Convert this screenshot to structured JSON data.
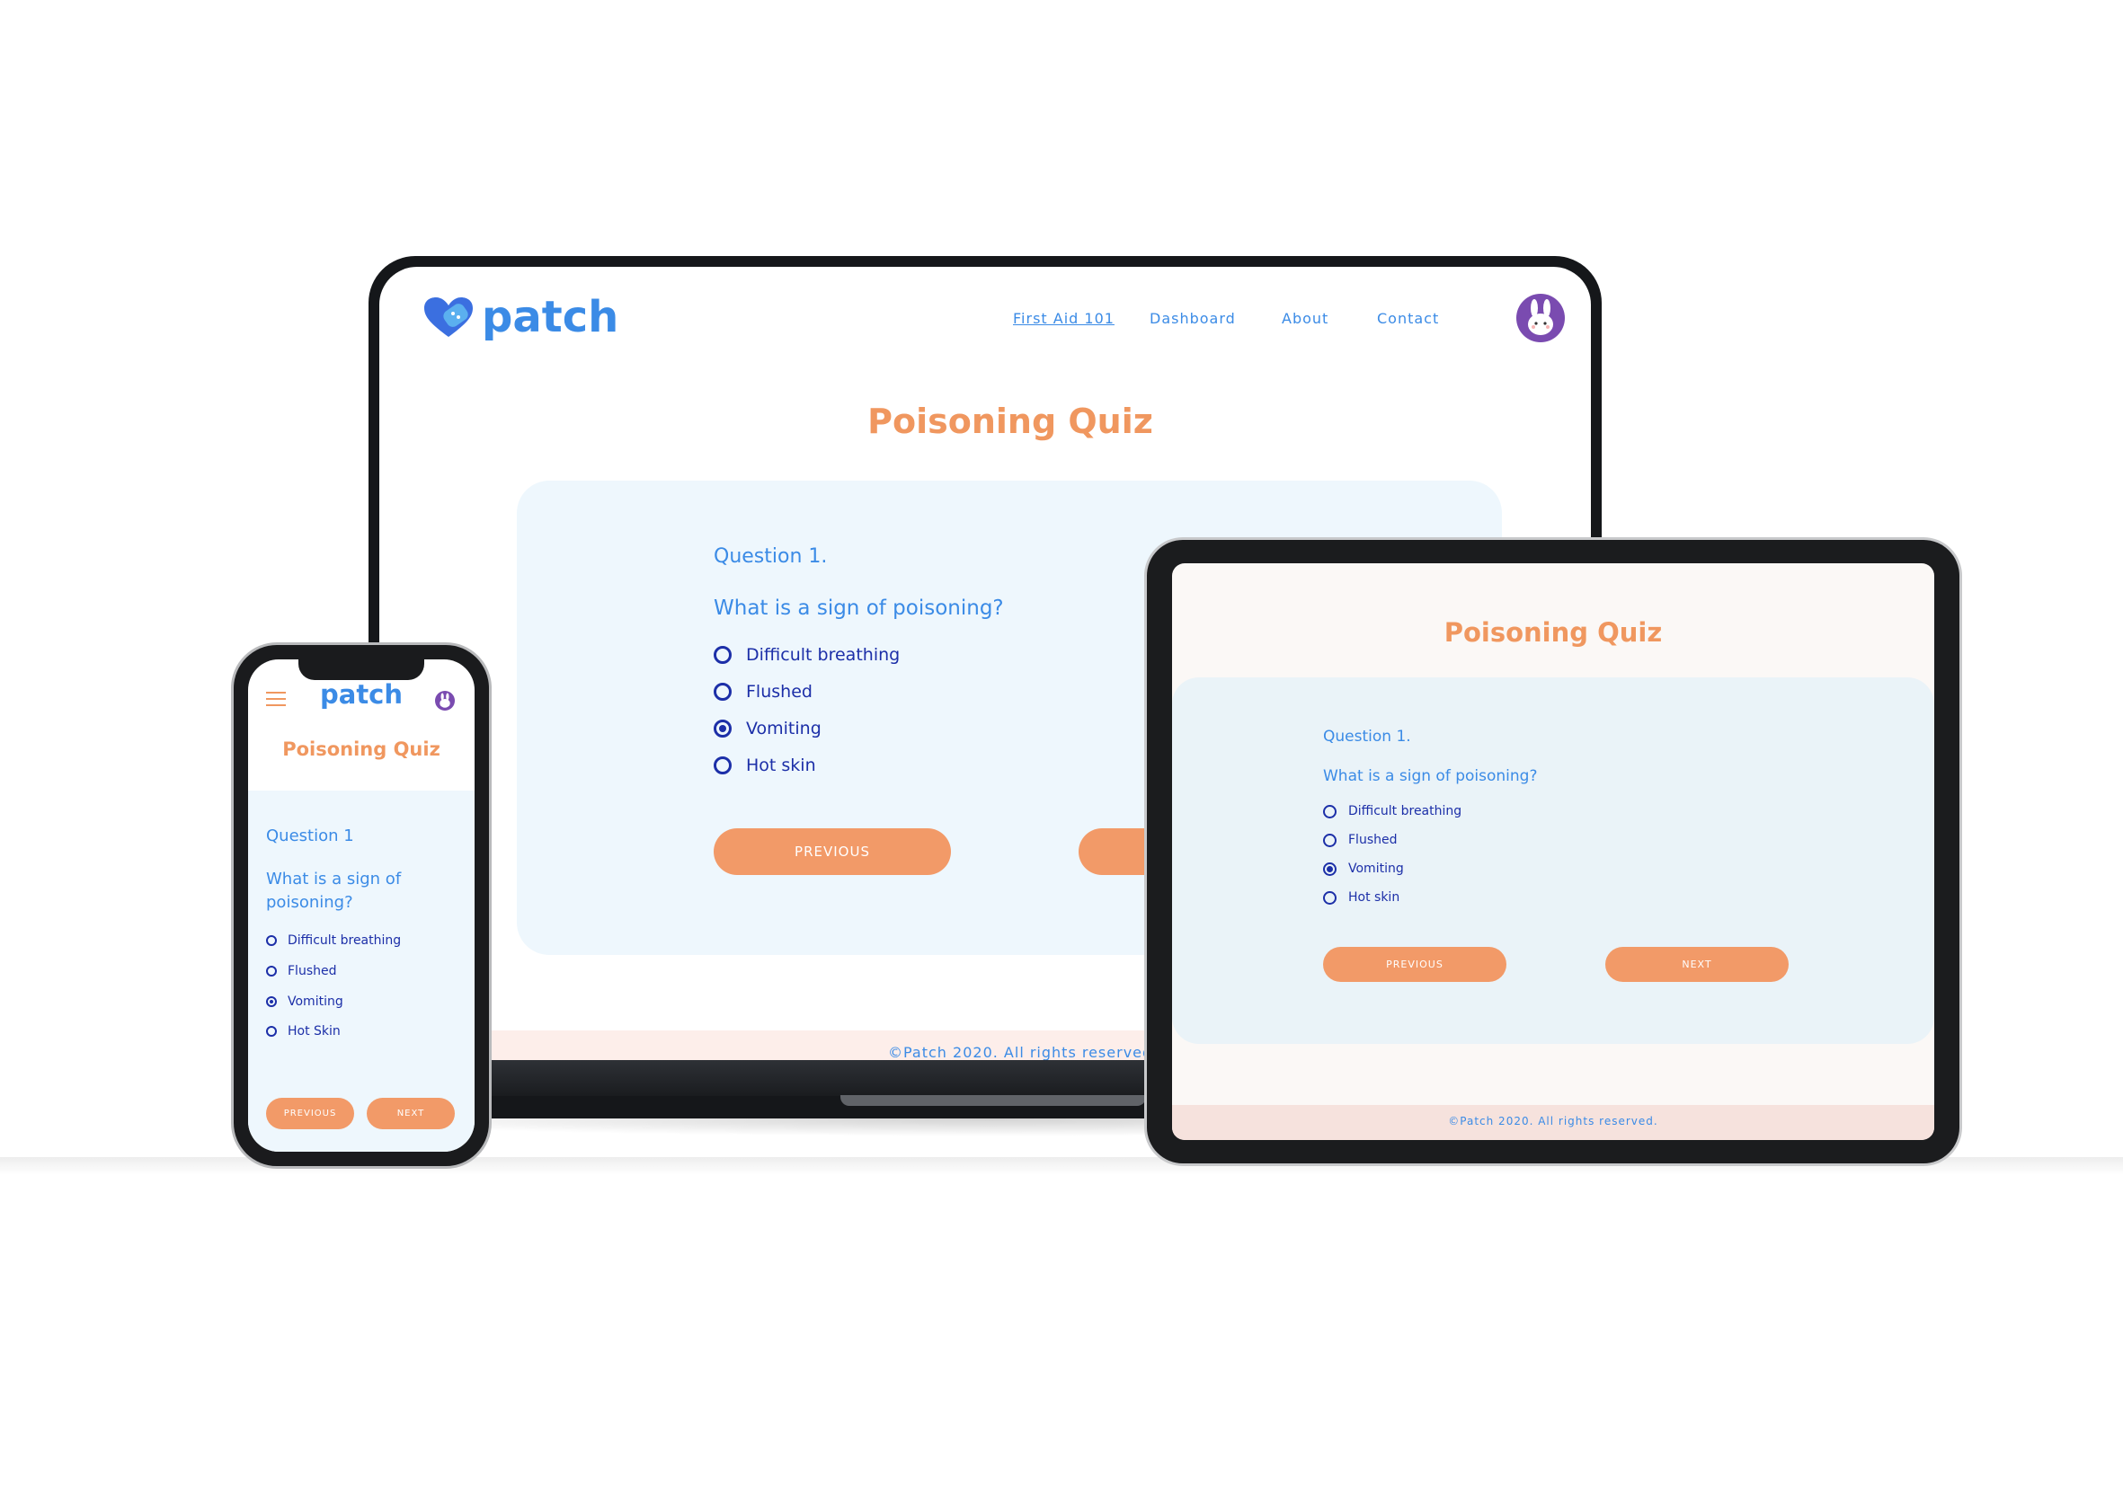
{
  "brand": {
    "name": "patch"
  },
  "nav": [
    {
      "label": "First Aid 101",
      "active": true
    },
    {
      "label": "Dashboard"
    },
    {
      "label": "About"
    },
    {
      "label": "Contact"
    }
  ],
  "quiz": {
    "title": "Poisoning Quiz",
    "question_number": "Question 1.",
    "question_number_mobile": "Question 1",
    "question_text": "What is a sign of poisoning?",
    "options": [
      {
        "label": "Difficult breathing",
        "selected": false
      },
      {
        "label": "Flushed",
        "selected": false
      },
      {
        "label": "Vomiting",
        "selected": true
      },
      {
        "label": "Hot skin",
        "selected": false
      }
    ],
    "mobile_last_option": "Hot Skin",
    "previous_label": "PREVIOUS",
    "next_label": "NEXT"
  },
  "footer": {
    "text": "©Patch 2020. All rights reserved."
  },
  "colors": {
    "accent_orange": "#f29a68",
    "title_orange": "#f0975f",
    "brand_blue": "#3b8be6",
    "option_navy": "#1c2fa8",
    "panel_bg": "#eef7fd",
    "avatar_purple": "#7a4bb0"
  },
  "icons": {
    "logo": "heart-bandage-icon",
    "menu": "hamburger-menu-icon",
    "avatar": "bunny-avatar-icon"
  }
}
